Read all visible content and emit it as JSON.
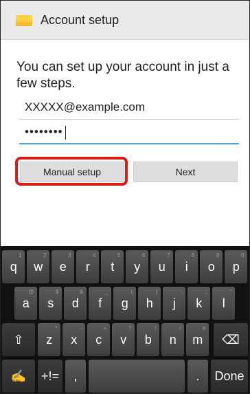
{
  "titlebar": {
    "title": "Account setup",
    "icon": "email-envelope-icon"
  },
  "form": {
    "intro": "You can set up your account in just a few steps.",
    "email_value": "XXXXX@example.com",
    "password_mask": "••••••••",
    "manual_setup_label": "Manual setup",
    "next_label": "Next"
  },
  "keyboard": {
    "row1": [
      {
        "k": "q",
        "s": "1"
      },
      {
        "k": "w",
        "s": "2"
      },
      {
        "k": "e",
        "s": "3"
      },
      {
        "k": "r",
        "s": "4"
      },
      {
        "k": "t",
        "s": "5"
      },
      {
        "k": "y",
        "s": "6"
      },
      {
        "k": "u",
        "s": "7"
      },
      {
        "k": "i",
        "s": "8"
      },
      {
        "k": "o",
        "s": "9"
      },
      {
        "k": "p",
        "s": "0"
      }
    ],
    "row2": [
      {
        "k": "a",
        "s": "@"
      },
      {
        "k": "s",
        "s": "$"
      },
      {
        "k": "d",
        "s": "&"
      },
      {
        "k": "f",
        "s": "_"
      },
      {
        "k": "g",
        "s": "("
      },
      {
        "k": "h",
        "s": ")"
      },
      {
        "k": "j",
        "s": ":"
      },
      {
        "k": "k",
        "s": ";"
      },
      {
        "k": "l",
        "s": "\""
      }
    ],
    "row3": [
      {
        "k": "z",
        "s": "*"
      },
      {
        "k": "x",
        "s": "-"
      },
      {
        "k": "c",
        "s": "+"
      },
      {
        "k": "v",
        "s": "?"
      },
      {
        "k": "b",
        "s": "!"
      },
      {
        "k": "n",
        "s": "/"
      },
      {
        "k": "m",
        "s": "#"
      }
    ],
    "shift_icon": "shift-arrow-icon",
    "backspace_icon": "backspace-icon",
    "swype_icon": "swype-icon",
    "symbols_label": "+!=",
    "comma": ",",
    "period": ".",
    "done_label": "Done"
  }
}
